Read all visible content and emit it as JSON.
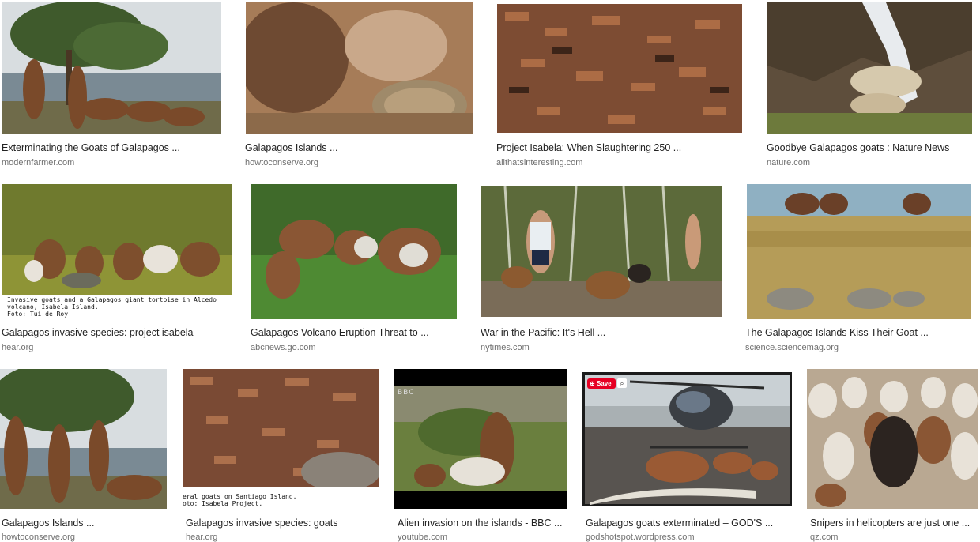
{
  "results": [
    {
      "caption": "Exterminating the Goats of Galapagos ...",
      "source": "modernfarmer.com"
    },
    {
      "caption": "Galapagos Islands ...",
      "source": "howtoconserve.org"
    },
    {
      "caption": "Project Isabela: When Slaughtering 250 ...",
      "source": "allthatsinteresting.com"
    },
    {
      "caption": "Goodbye Galapagos goats : Nature News",
      "source": "nature.com"
    },
    {
      "caption": "Galapagos invasive species: project isabela",
      "source": "hear.org",
      "overlay_lines": [
        "Invasive goats and a Galapagos giant tortoise in Alcedo",
        "volcano, Isabela Island.",
        "Foto: Tui de Roy"
      ]
    },
    {
      "caption": "Galapagos Volcano Eruption Threat to ...",
      "source": "abcnews.go.com"
    },
    {
      "caption": "War in the Pacific: It's Hell ...",
      "source": "nytimes.com"
    },
    {
      "caption": "The Galapagos Islands Kiss Their Goat ...",
      "source": "science.sciencemag.org"
    },
    {
      "caption": "Galapagos Islands ...",
      "source": "howtoconserve.org"
    },
    {
      "caption": "Galapagos invasive species: goats",
      "source": "hear.org",
      "overlay_lines": [
        "eral goats on Santiago Island.",
        "oto: Isabela Project."
      ]
    },
    {
      "caption": "Alien invasion on the islands - BBC ...",
      "source": "youtube.com",
      "watermark": "BBC"
    },
    {
      "caption": "Galapagos goats exterminated – GOD'S ...",
      "source": "godshotspot.wordpress.com",
      "save_label": "Save"
    },
    {
      "caption": "Snipers in helicopters are just one ...",
      "source": "qz.com"
    }
  ],
  "colors": {
    "caption": "#222222",
    "source": "#707070",
    "pin_red": "#e60023"
  }
}
